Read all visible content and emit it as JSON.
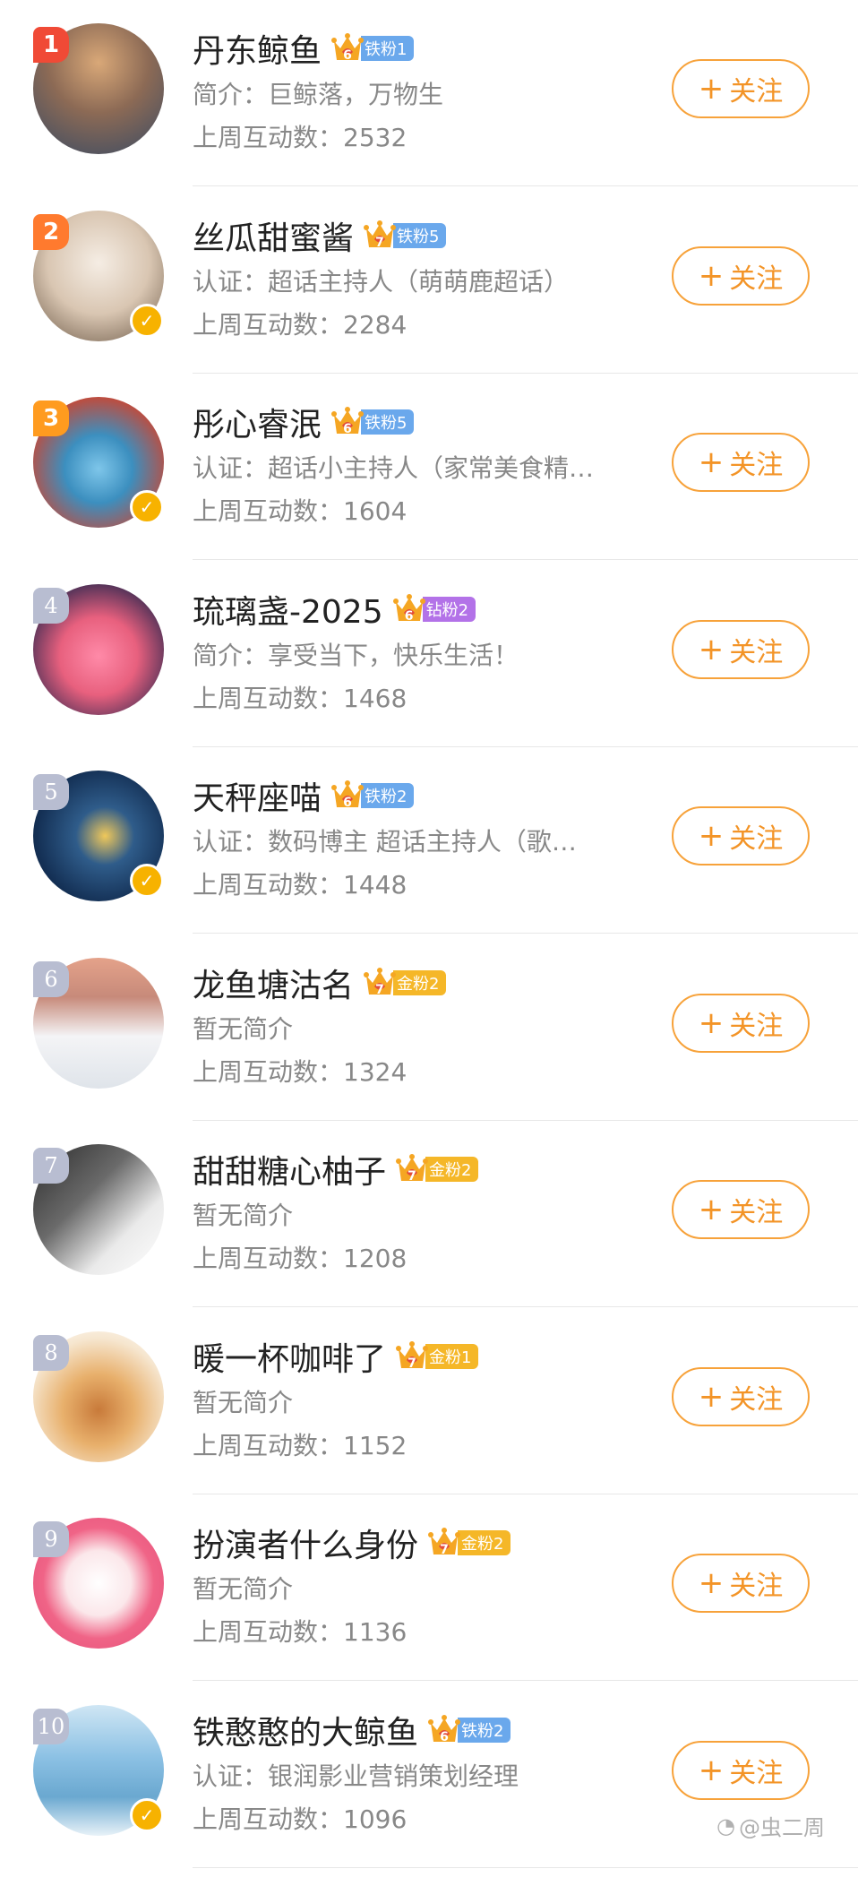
{
  "follow_label": "关注",
  "watermark": "@虫二周",
  "rows": [
    {
      "rank": "1",
      "name": "丹东鲸鱼",
      "fan_level": "6",
      "fan_tag": "铁粉1",
      "fan_color": "#6aa8ec",
      "desc": "简介：巨鲸落，万物生",
      "stat": "上周互动数：2532",
      "verified": false
    },
    {
      "rank": "2",
      "name": "丝瓜甜蜜酱",
      "fan_level": "7",
      "fan_tag": "铁粉5",
      "fan_color": "#6aa8ec",
      "desc": "认证：超话主持人（萌萌鹿超话）",
      "stat": "上周互动数：2284",
      "verified": true
    },
    {
      "rank": "3",
      "name": "彤心睿泯",
      "fan_level": "6",
      "fan_tag": "铁粉5",
      "fan_color": "#6aa8ec",
      "desc": "认证：超话小主持人（家常美食精…",
      "stat": "上周互动数：1604",
      "verified": true
    },
    {
      "rank": "4",
      "name": "琉璃盏-2025",
      "fan_level": "6",
      "fan_tag": "钻粉2",
      "fan_color": "#b372e8",
      "desc": "简介：享受当下，快乐生活！",
      "stat": "上周互动数：1468",
      "verified": false
    },
    {
      "rank": "5",
      "name": "天秤座喵",
      "fan_level": "6",
      "fan_tag": "铁粉2",
      "fan_color": "#6aa8ec",
      "desc": "认证：数码博主 超话主持人（歌…",
      "stat": "上周互动数：1448",
      "verified": true
    },
    {
      "rank": "6",
      "name": "龙鱼塘沽名",
      "fan_level": "7",
      "fan_tag": "金粉2",
      "fan_color": "#f5b728",
      "desc": "暂无简介",
      "stat": "上周互动数：1324",
      "verified": false
    },
    {
      "rank": "7",
      "name": "甜甜糖心柚子",
      "fan_level": "7",
      "fan_tag": "金粉2",
      "fan_color": "#f5b728",
      "desc": "暂无简介",
      "stat": "上周互动数：1208",
      "verified": false
    },
    {
      "rank": "8",
      "name": "暖一杯咖啡了",
      "fan_level": "7",
      "fan_tag": "金粉1",
      "fan_color": "#f5b728",
      "desc": "暂无简介",
      "stat": "上周互动数：1152",
      "verified": false
    },
    {
      "rank": "9",
      "name": "扮演者什么身份",
      "fan_level": "7",
      "fan_tag": "金粉2",
      "fan_color": "#f5b728",
      "desc": "暂无简介",
      "stat": "上周互动数：1136",
      "verified": false
    },
    {
      "rank": "10",
      "name": "铁憨憨的大鲸鱼",
      "fan_level": "6",
      "fan_tag": "铁粉2",
      "fan_color": "#6aa8ec",
      "desc": "认证：银润影业营销策划经理",
      "stat": "上周互动数：1096",
      "verified": true
    }
  ]
}
